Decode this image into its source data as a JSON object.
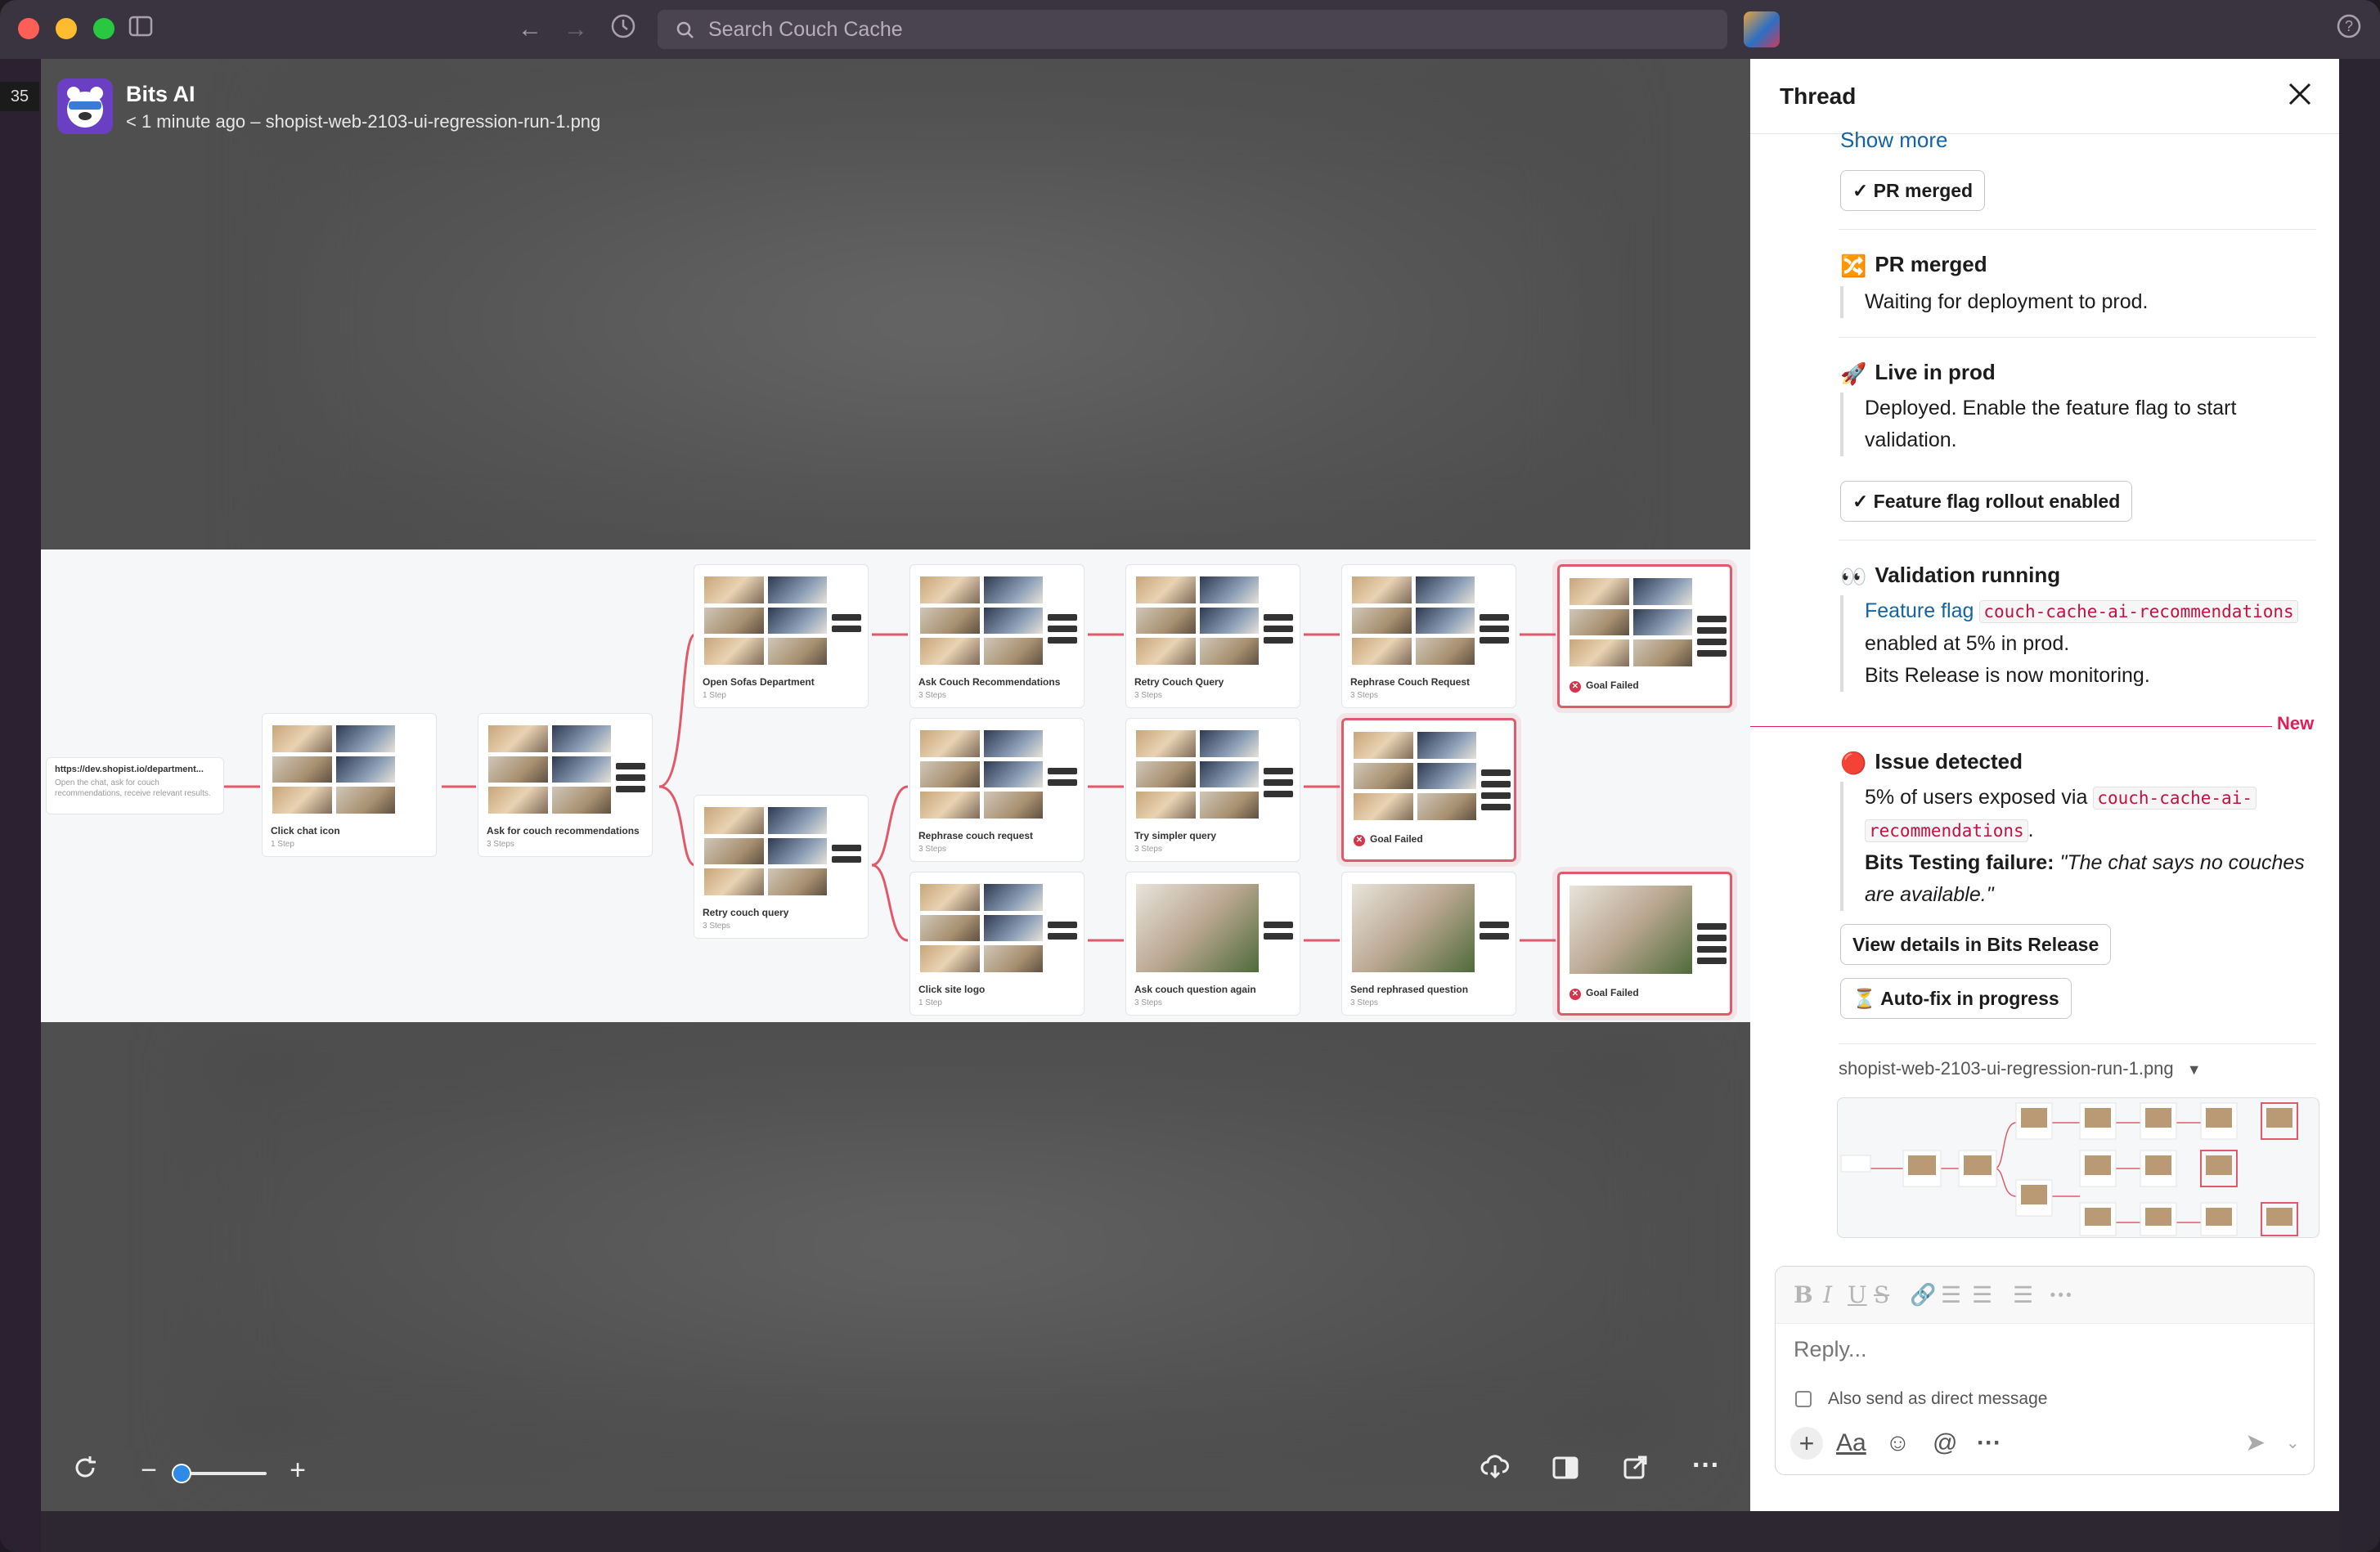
{
  "window": {
    "search_placeholder": "Search Couch Cache",
    "badge_count": "35",
    "colors": {
      "titlebar": "#3a3441",
      "close": "#ff5f57",
      "minimize": "#febc2e",
      "zoom": "#28c840"
    }
  },
  "viewer": {
    "sender": "Bits AI",
    "subtitle": "< 1 minute ago – shopist-web-2103-ui-regression-run-1.png",
    "flow": {
      "start_url": "https://dev.shopist.io/department...",
      "start_desc": "Open the chat, ask for couch recommendations, receive relevant results.",
      "nodes": [
        {
          "label": "Click chat icon",
          "steps": "1 Step"
        },
        {
          "label": "Ask for couch recommendations",
          "steps": "3 Steps"
        },
        {
          "label": "Open Sofas Department",
          "steps": "1 Step"
        },
        {
          "label": "Ask Couch Recommendations",
          "steps": "3 Steps"
        },
        {
          "label": "Retry Couch Query",
          "steps": "3 Steps"
        },
        {
          "label": "Rephrase Couch Request",
          "steps": "3 Steps"
        },
        {
          "label": "Retry couch query",
          "steps": "3 Steps"
        },
        {
          "label": "Rephrase couch request",
          "steps": "3 Steps"
        },
        {
          "label": "Try simpler query",
          "steps": "3 Steps"
        },
        {
          "label": "Click site logo",
          "steps": "1 Step"
        },
        {
          "label": "Ask couch question again",
          "steps": "3 Steps"
        },
        {
          "label": "Send rephrased question",
          "steps": "3 Steps"
        }
      ],
      "goal_failed": "Goal Failed"
    }
  },
  "thread": {
    "title": "Thread",
    "show_more": "Show more",
    "pr_merged_button": "✓ PR merged",
    "sections": {
      "pr_merged": {
        "emoji": "🔀",
        "title": "PR merged",
        "body": "Waiting for deployment to prod."
      },
      "live": {
        "emoji": "🚀",
        "title": "Live in prod",
        "body": "Deployed. Enable the feature flag to start validation."
      },
      "flag_button": "✓ Feature flag rollout enabled",
      "validation": {
        "emoji": "👀",
        "title": "Validation running",
        "link": "Feature flag",
        "flag": "couch-cache-ai-recommendations",
        "line2": "enabled at 5% in prod.",
        "line3": "Bits Release is now monitoring."
      },
      "new_label": "New",
      "issue": {
        "emoji": "🔴",
        "title": "Issue detected",
        "line1": "5% of users exposed via",
        "flag_a": "couch-cache-ai-",
        "flag_b": "recommendations",
        "failure_label": "Bits Testing failure:",
        "failure_quote": "\"The chat says no couches are available.\""
      },
      "view_button": "View details in Bits Release",
      "autofix_button": "⏳ Auto-fix in progress"
    },
    "attachment": {
      "name": "shopist-web-2103-ui-regression-run-1.png"
    },
    "composer": {
      "placeholder": "Reply...",
      "dm_label": "Also send as direct message"
    }
  }
}
